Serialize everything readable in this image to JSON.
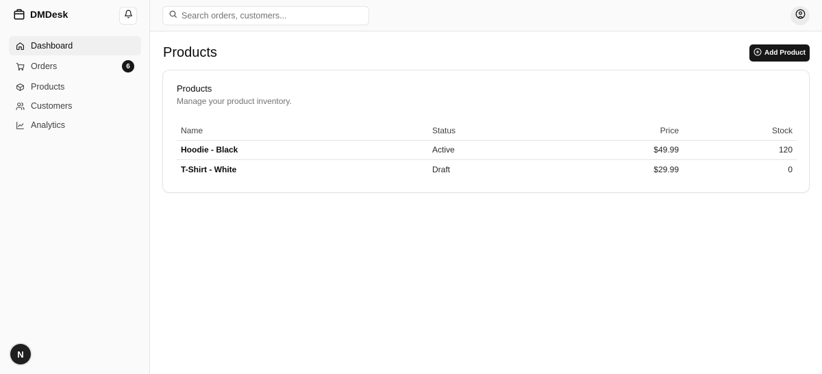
{
  "app": {
    "name": "DMDesk"
  },
  "sidebar": {
    "items": [
      {
        "label": "Dashboard",
        "icon": "home-icon",
        "active": true
      },
      {
        "label": "Orders",
        "icon": "cart-icon",
        "badge": "6"
      },
      {
        "label": "Products",
        "icon": "package-icon"
      },
      {
        "label": "Customers",
        "icon": "users-icon"
      },
      {
        "label": "Analytics",
        "icon": "line-chart-icon"
      }
    ],
    "avatar_initial": "N"
  },
  "header": {
    "search_placeholder": "Search orders, customers..."
  },
  "page": {
    "title": "Products",
    "add_button_label": "Add Product"
  },
  "card": {
    "title": "Products",
    "description": "Manage your product inventory."
  },
  "table": {
    "columns": [
      "Name",
      "Status",
      "Price",
      "Stock"
    ],
    "rows": [
      {
        "name": "Hoodie - Black",
        "status": "Active",
        "price": "$49.99",
        "stock": "120"
      },
      {
        "name": "T-Shirt - White",
        "status": "Draft",
        "price": "$29.99",
        "stock": "0"
      }
    ]
  },
  "colors": {
    "primary": "#171717",
    "border": "#e5e5e5",
    "sidebar_bg": "#fafafa",
    "muted_text": "#737373"
  }
}
